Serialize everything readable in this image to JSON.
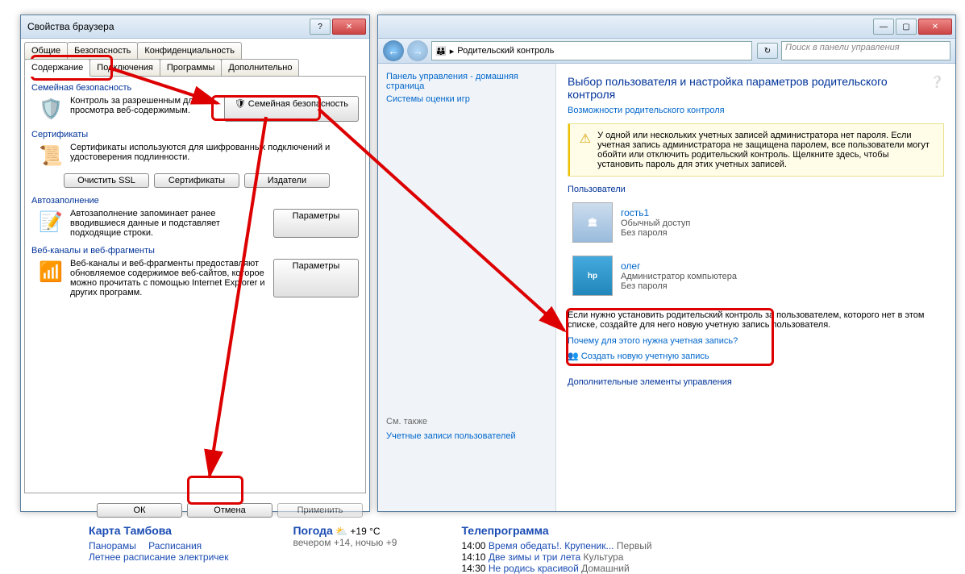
{
  "dlg": {
    "title": "Свойства браузера",
    "tabs_row1": [
      "Общие",
      "Безопасность",
      "Конфиденциальность"
    ],
    "tabs_row2": [
      "Содержание",
      "Подключения",
      "Программы",
      "Дополнительно"
    ],
    "family": {
      "group": "Семейная безопасность",
      "text": "Контроль за разрешенным для просмотра веб-содержимым.",
      "btn": "Семейная безопасность"
    },
    "cert": {
      "group": "Сертификаты",
      "text": "Сертификаты используются для шифрованных подключений и удостоверения подлинности.",
      "clear": "Очистить SSL",
      "certs": "Сертификаты",
      "pub": "Издатели"
    },
    "auto": {
      "group": "Автозаполнение",
      "text": "Автозаполнение запоминает ранее вводившиеся данные и подставляет подходящие строки.",
      "btn": "Параметры"
    },
    "feeds": {
      "group": "Веб-каналы и веб-фрагменты",
      "text": "Веб-каналы и веб-фрагменты предоставляют обновляемое содержимое веб-сайтов, которое можно прочитать с помощью Internet Explorer и других программ.",
      "btn": "Параметры"
    },
    "ok": "ОК",
    "cancel": "Отмена",
    "apply": "Применить"
  },
  "cp": {
    "breadcrumb": "Родительский контроль",
    "search_ph": "Поиск в панели управления",
    "side": {
      "main": "Панель управления - домашняя страница",
      "rating": "Системы оценки игр",
      "see": "См. также",
      "accounts": "Учетные записи пользователей"
    },
    "title": "Выбор пользователя и настройка параметров родительского контроля",
    "link1": "Возможности родительского контроля",
    "warn": "У одной или нескольких учетных записей администратора нет пароля. Если учетная запись администратора не защищена паролем, все пользователи могут обойти или отключить родительский контроль. Щелкните здесь, чтобы установить пароль для этих учетных записей.",
    "users_label": "Пользователи",
    "u1": {
      "name": "гость1",
      "type": "Обычный доступ",
      "pw": "Без пароля"
    },
    "u2": {
      "name": "олег",
      "type": "Администратор компьютера",
      "pw": "Без пароля"
    },
    "note": "Если нужно установить родительский контроль за пользователем, которого нет в этом списке, создайте для него новую учетную запись пользователя.",
    "why": "Почему для этого нужна учетная запись?",
    "create": "Создать новую учетную запись",
    "extra": "Дополнительные элементы управления"
  },
  "portal": {
    "map": {
      "title": "Карта Тамбова",
      "p1": "Панорамы",
      "p2": "Расписания",
      "p3": "Летнее расписание электричек"
    },
    "weather": {
      "title": "Погода",
      "now": "+19 °C",
      "later": "вечером +14,  ночью +9"
    },
    "tv": {
      "title": "Телепрограмма",
      "i1": {
        "t": "14:00",
        "s": "Время обедать!. Крупеник...",
        "c": "Первый"
      },
      "i2": {
        "t": "14:10",
        "s": "Две зимы и три лета",
        "c": "Культура"
      },
      "i3": {
        "t": "14:30",
        "s": "Не родись красивой",
        "c": "Домашний"
      }
    }
  }
}
